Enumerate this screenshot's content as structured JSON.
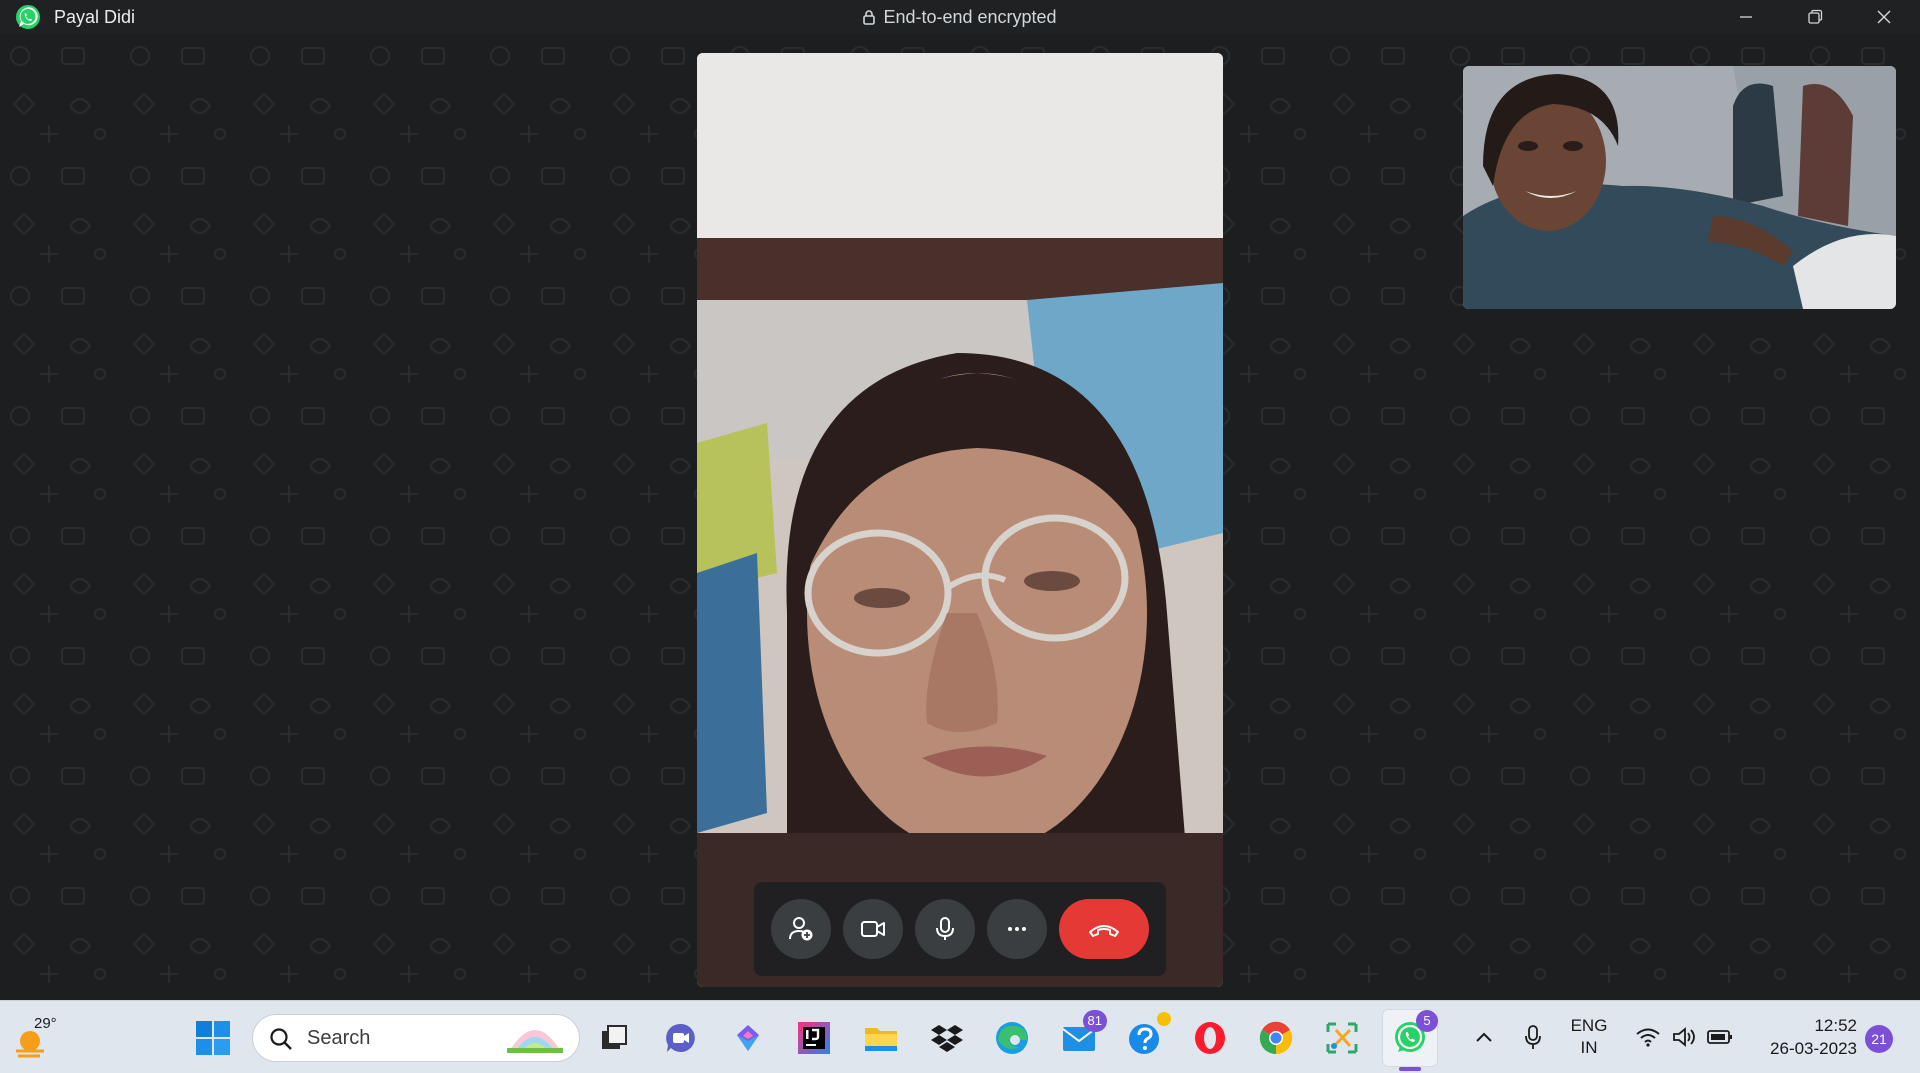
{
  "titlebar": {
    "contact_name": "Payal Didi",
    "encryption_label": "End-to-end encrypted"
  },
  "call": {
    "remote_video": "remote-participant-video",
    "self_video": "self-preview-video",
    "controls": [
      {
        "name": "add-participant",
        "icon": "person-add-icon"
      },
      {
        "name": "toggle-video",
        "icon": "video-camera-icon"
      },
      {
        "name": "toggle-mic",
        "icon": "microphone-icon"
      },
      {
        "name": "more-options",
        "icon": "more-horizontal-icon"
      },
      {
        "name": "end-call",
        "icon": "phone-hangup-icon",
        "color": "#e53935"
      }
    ]
  },
  "taskbar": {
    "weather_temp": "29°",
    "search_label": "Search",
    "apps": [
      {
        "name": "start",
        "icon": "windows-icon"
      },
      {
        "name": "task-view",
        "icon": "task-view-icon"
      },
      {
        "name": "teams-chat",
        "icon": "chat-video-icon"
      },
      {
        "name": "copilot",
        "icon": "copilot-icon"
      },
      {
        "name": "intellij",
        "icon": "intellij-icon"
      },
      {
        "name": "file-explorer",
        "icon": "folder-icon"
      },
      {
        "name": "dropbox",
        "icon": "dropbox-icon"
      },
      {
        "name": "edge",
        "icon": "edge-icon"
      },
      {
        "name": "mail",
        "icon": "mail-icon",
        "badge": "81"
      },
      {
        "name": "get-help",
        "icon": "help-icon"
      },
      {
        "name": "opera",
        "icon": "opera-icon"
      },
      {
        "name": "chrome",
        "icon": "chrome-icon"
      },
      {
        "name": "snipping-tool",
        "icon": "snipping-icon"
      },
      {
        "name": "whatsapp",
        "icon": "whatsapp-icon",
        "badge": "5"
      }
    ],
    "tray": {
      "lang_line1": "ENG",
      "lang_line2": "IN",
      "time": "12:52",
      "date": "26-03-2023",
      "notification_count": "21"
    }
  },
  "colors": {
    "whatsapp_green": "#25d366",
    "end_call_red": "#e53935",
    "badge_purple": "#7b4fd6",
    "stage_bg": "#1c1e20"
  }
}
